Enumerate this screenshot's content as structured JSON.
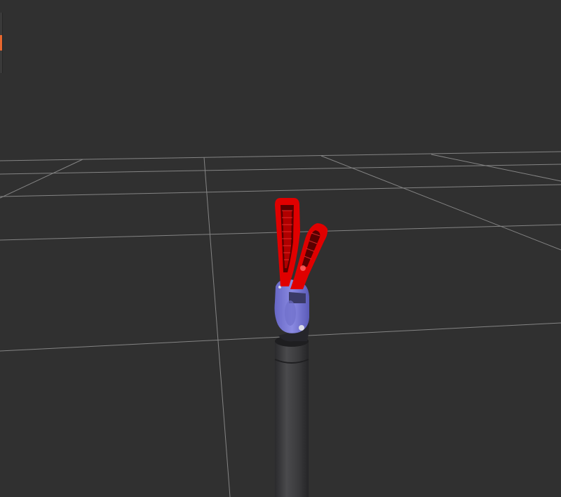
{
  "viewport": {
    "background": "#303030",
    "grid_color": "#a0a0a0"
  },
  "model": {
    "gripper_fingers_color": "#e00000",
    "wrist_color": "#7a7ad8",
    "arm_shaft_color": "#3c3c3e",
    "joint_pin_color": "#dcdce8"
  },
  "left_panel": {
    "accent_color": "#e8672e"
  }
}
